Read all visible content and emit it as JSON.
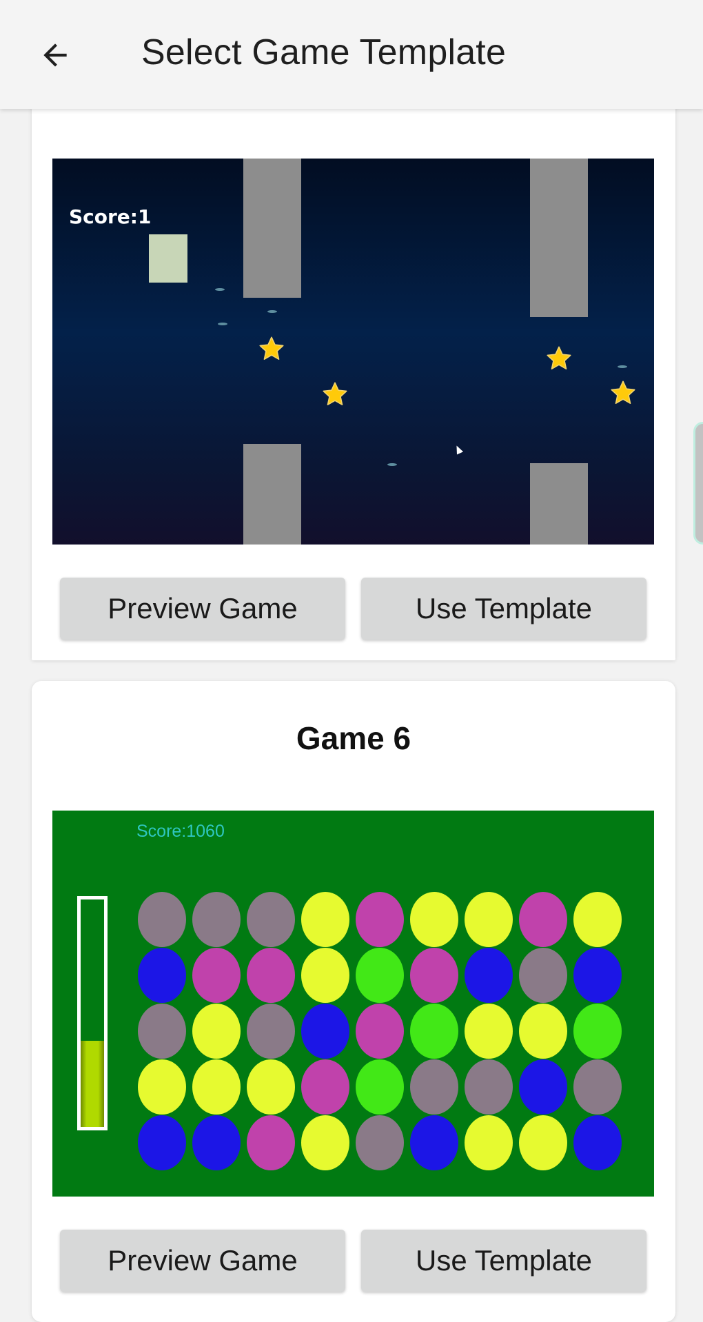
{
  "appbar": {
    "title": "Select Game Template",
    "back_icon": "arrow-left-icon"
  },
  "cards": [
    {
      "title": "",
      "preview": {
        "kind": "space-flappy",
        "score_text": "Score:1"
      },
      "buttons": {
        "preview": "Preview Game",
        "use": "Use Template"
      }
    },
    {
      "title": "Game 6",
      "preview": {
        "kind": "match-gems",
        "score_text": "Score:1060",
        "meter_fill_fraction": 0.38,
        "grid": [
          [
            "gray",
            "gray",
            "gray",
            "yellow",
            "magenta",
            "yellow",
            "yellow",
            "magenta",
            "yellow"
          ],
          [
            "blue",
            "magenta",
            "magenta",
            "yellow",
            "green",
            "magenta",
            "blue",
            "gray",
            "blue"
          ],
          [
            "gray",
            "yellow",
            "gray",
            "blue",
            "magenta",
            "green",
            "yellow",
            "yellow",
            "green"
          ],
          [
            "yellow",
            "yellow",
            "yellow",
            "magenta",
            "green",
            "gray",
            "gray",
            "blue",
            "gray"
          ],
          [
            "blue",
            "blue",
            "magenta",
            "yellow",
            "gray",
            "blue",
            "yellow",
            "yellow",
            "blue"
          ]
        ]
      },
      "buttons": {
        "preview": "Preview Game",
        "use": "Use Template"
      }
    }
  ],
  "colors": {
    "gray": "#8a7a88",
    "yellow": "#e6fa30",
    "magenta": "#c042ab",
    "blue": "#1c16e6",
    "green": "#42e817"
  }
}
